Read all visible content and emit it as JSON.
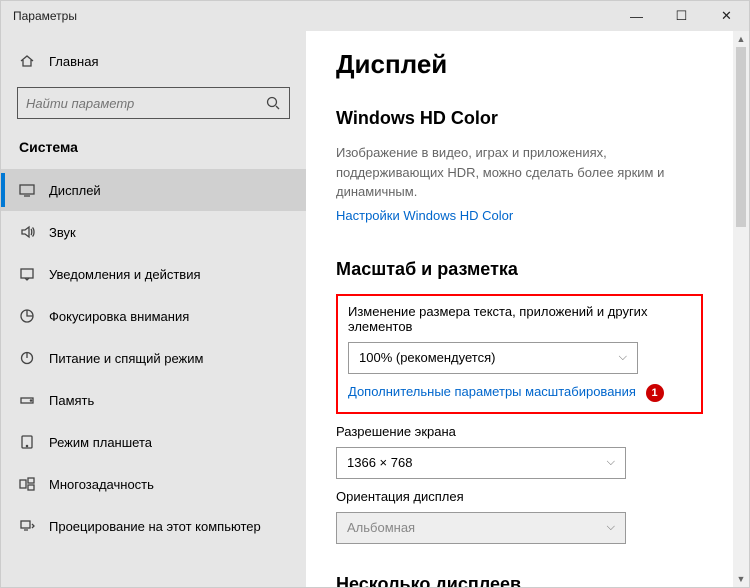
{
  "titlebar": {
    "title": "Параметры"
  },
  "sidebar": {
    "home": "Главная",
    "search_placeholder": "Найти параметр",
    "section": "Система",
    "items": [
      {
        "label": "Дисплей"
      },
      {
        "label": "Звук"
      },
      {
        "label": "Уведомления и действия"
      },
      {
        "label": "Фокусировка внимания"
      },
      {
        "label": "Питание и спящий режим"
      },
      {
        "label": "Память"
      },
      {
        "label": "Режим планшета"
      },
      {
        "label": "Многозадачность"
      },
      {
        "label": "Проецирование на этот компьютер"
      }
    ]
  },
  "content": {
    "h1": "Дисплей",
    "hd": {
      "title": "Windows HD Color",
      "desc": "Изображение в видео, играх и приложениях, поддерживающих HDR, можно сделать более ярким и динамичным.",
      "link": "Настройки Windows HD Color"
    },
    "scale": {
      "title": "Масштаб и разметка",
      "change_label": "Изменение размера текста, приложений и других элементов",
      "scale_value": "100% (рекомендуется)",
      "advanced_link": "Дополнительные параметры масштабирования",
      "badge": "1",
      "res_label": "Разрешение экрана",
      "res_value": "1366 × 768",
      "orient_label": "Ориентация дисплея",
      "orient_value": "Альбомная"
    },
    "multi": {
      "title": "Несколько дисплеев"
    }
  }
}
